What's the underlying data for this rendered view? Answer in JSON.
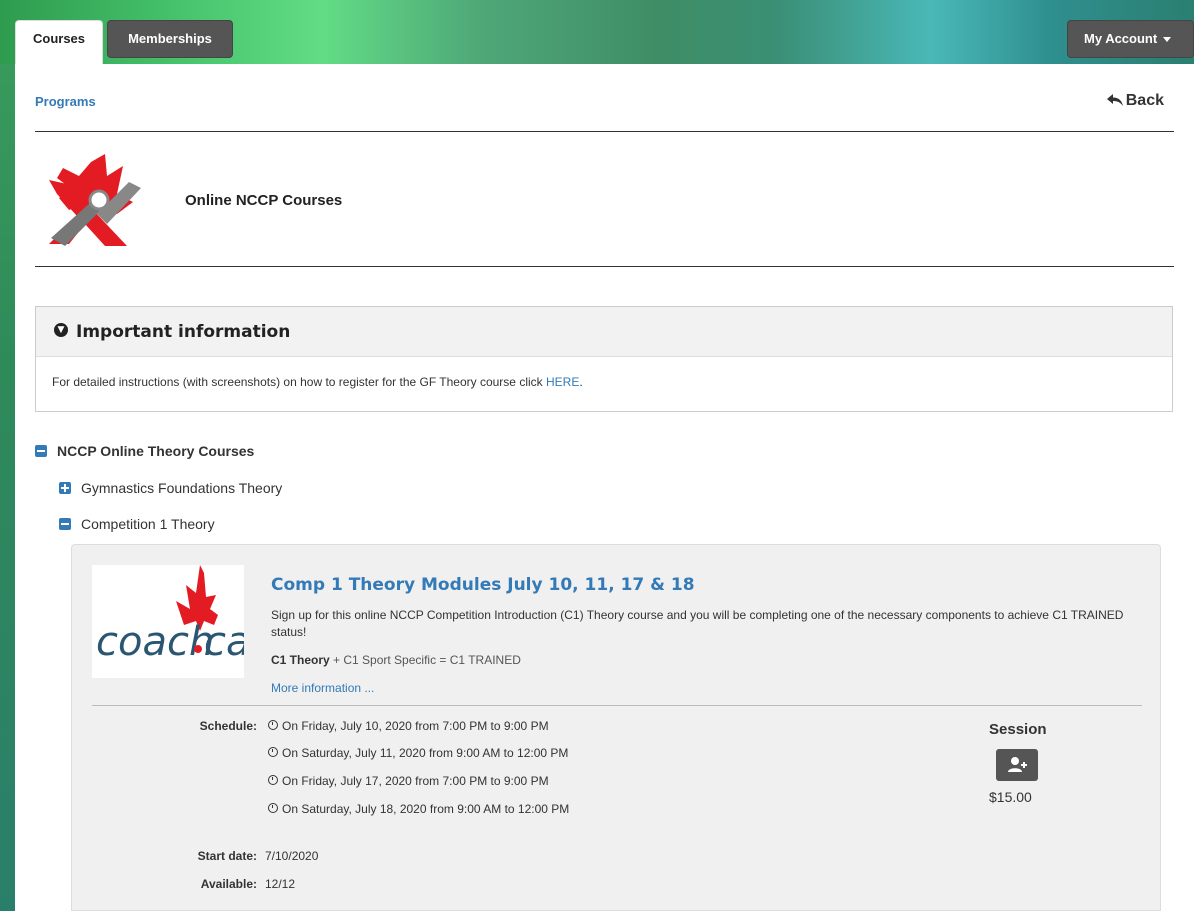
{
  "nav": {
    "tabs": [
      "Courses",
      "Memberships"
    ],
    "account_label": "My Account"
  },
  "breadcrumb": "Programs",
  "back_label": "Back",
  "program": {
    "title": "Online NCCP Courses"
  },
  "info": {
    "heading": "Important information",
    "text": "For detailed instructions (with screenshots) on how to register for the GF Theory course click ",
    "link": "HERE",
    "after": "."
  },
  "tree": {
    "root": "NCCP Online Theory Courses",
    "children": [
      "Gymnastics Foundations Theory",
      "Competition 1 Theory"
    ]
  },
  "course": {
    "logo_text_left": "coach",
    "logo_text_right": "ca",
    "title": "Comp 1 Theory Modules July 10, 11, 17 & 18",
    "description": "Sign up for this online NCCP Competition Introduction (C1) Theory course and you will be completing one of the necessary components to achieve C1 TRAINED status!",
    "formula_bold": "C1 Theory",
    "formula_rest": " + C1 Sport Specific = C1 TRAINED",
    "more": "More information ...",
    "schedule_label": "Schedule:",
    "schedule": [
      "On Friday, July 10, 2020 from 7:00 PM to 9:00 PM",
      "On Saturday, July 11, 2020 from 9:00 AM to 12:00 PM",
      "On Friday, July 17, 2020 from 7:00 PM to 9:00 PM",
      "On Saturday, July 18, 2020 from 9:00 AM to 12:00 PM"
    ],
    "start_label": "Start date:",
    "start_value": "7/10/2020",
    "available_label": "Available:",
    "available_value": "12/12",
    "session_label": "Session",
    "price": "$15.00"
  },
  "colors": {
    "link": "#337ab7",
    "dark_button": "#555555",
    "logo_red": "#e31b23"
  }
}
